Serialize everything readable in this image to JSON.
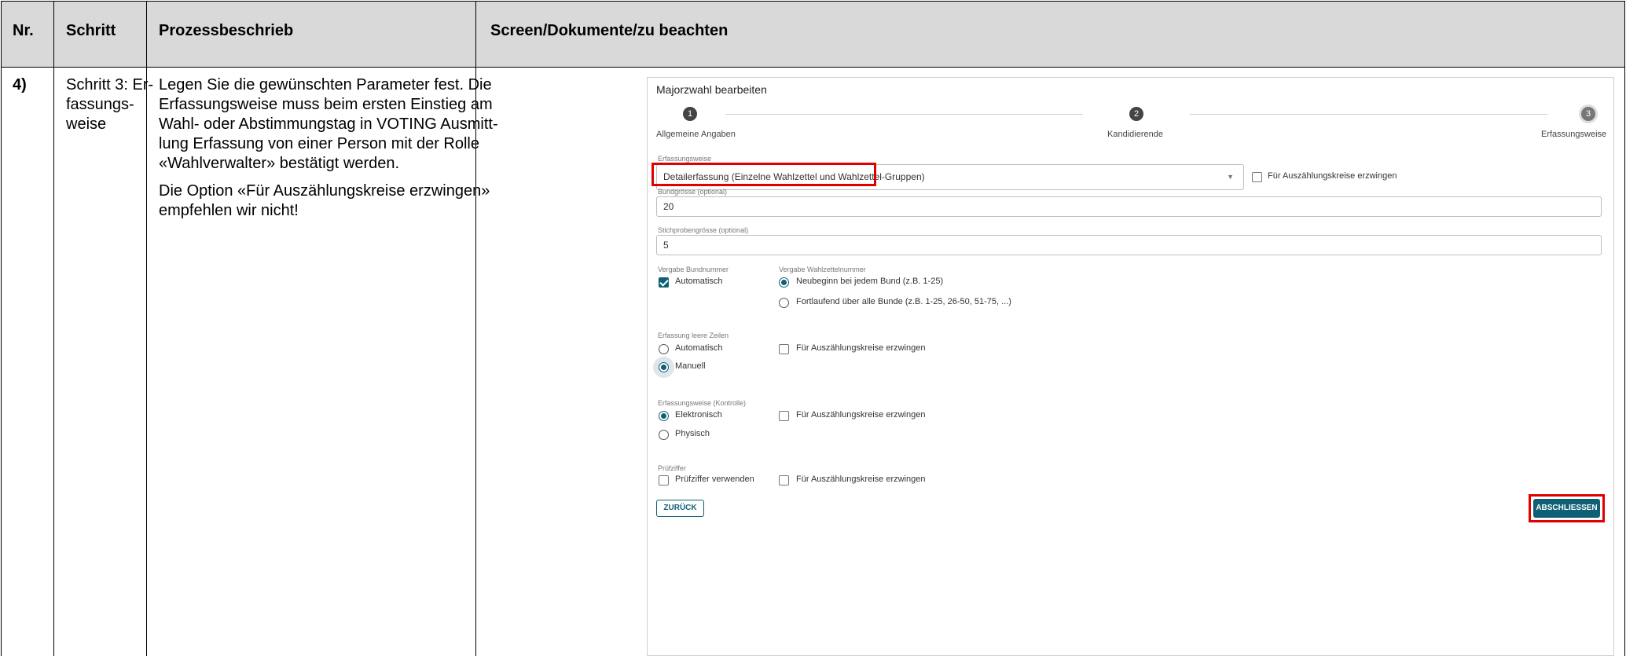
{
  "table": {
    "headers": {
      "nr": "Nr.",
      "schritt": "Schritt",
      "prozess": "Prozessbeschrieb",
      "screen": "Screen/Dokumente/zu beachten"
    },
    "row": {
      "nr": "4)",
      "schritt_lines": [
        "Schritt 3: Er-",
        "fassungs-",
        "weise"
      ],
      "prozess_p1_lines": [
        "Legen Sie die gewünschten Parameter fest. Die",
        "Erfassungsweise muss beim ersten Einstieg am",
        "Wahl- oder Abstimmungstag in VOTING Ausmitt-",
        "lung Erfassung von einer Person mit der Rolle",
        "«Wahlverwalter» bestätigt werden."
      ],
      "prozess_p2_lines": [
        "Die Option «Für Auszählungskreise erzwingen»",
        "empfehlen wir nicht!"
      ]
    }
  },
  "app": {
    "title": "Majorzwahl bearbeiten",
    "steps": [
      {
        "number": "1",
        "label": "Allgemeine Angaben"
      },
      {
        "number": "2",
        "label": "Kandidierende"
      },
      {
        "number": "3",
        "label": "Erfassungsweise"
      }
    ],
    "erfassungsweise": {
      "label": "Erfassungsweise",
      "value": "Detailerfassung (Einzelne Wahlzettel und Wahlzettel-Gruppen)",
      "force_label": "Für Auszählungskreise erzwingen",
      "force_checked": false
    },
    "bundgroesse": {
      "label": "Bundgrösse (optional)",
      "value": "20"
    },
    "stichprobe": {
      "label": "Stichprobengrösse (optional)",
      "value": "5"
    },
    "vergabe_bundnummer": {
      "label": "Vergabe Bundnummer",
      "option": "Automatisch",
      "checked": true
    },
    "vergabe_wahlzettelnummer": {
      "label": "Vergabe Wahlzettelnummer",
      "options": [
        {
          "label": "Neubeginn bei jedem Bund (z.B. 1-25)",
          "selected": true
        },
        {
          "label": "Fortlaufend über alle Bunde (z.B. 1-25, 26-50, 51-75, ...)",
          "selected": false
        }
      ]
    },
    "leere_zeilen": {
      "label": "Erfassung leere Zeilen",
      "options": [
        {
          "label": "Automatisch",
          "selected": false
        },
        {
          "label": "Manuell",
          "selected": true
        }
      ],
      "force_label": "Für Auszählungskreise erzwingen",
      "force_checked": false
    },
    "kontrolle": {
      "label": "Erfassungsweise (Kontrolle)",
      "options": [
        {
          "label": "Elektronisch",
          "selected": true
        },
        {
          "label": "Physisch",
          "selected": false
        }
      ],
      "force_label": "Für Auszählungskreise erzwingen",
      "force_checked": false
    },
    "pruefziffer": {
      "label": "Prüfziffer",
      "option": "Prüfziffer verwenden",
      "checked": false,
      "force_label": "Für Auszählungskreise erzwingen",
      "force_checked": false
    },
    "buttons": {
      "back": "ZURÜCK",
      "finish": "ABSCHLIESSEN"
    },
    "colors": {
      "accent": "#0f5f75",
      "highlight": "#e00000",
      "header_bg": "#d9d9d9"
    }
  }
}
